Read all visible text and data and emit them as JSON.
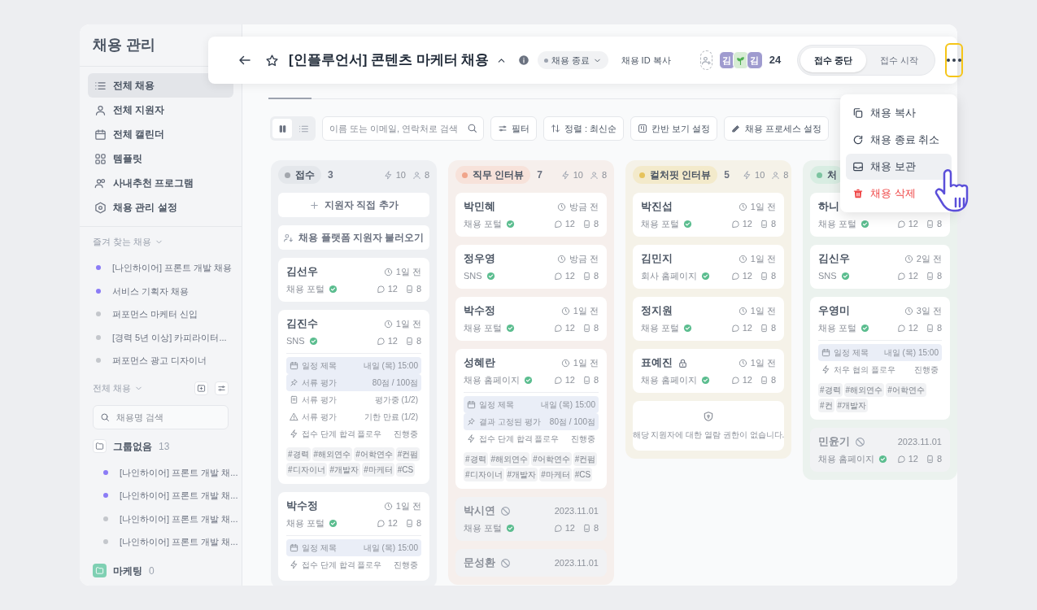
{
  "sidebar": {
    "title": "채용 관리",
    "nav": [
      {
        "label": "전체 채용",
        "selected": true
      },
      {
        "label": "전체 지원자",
        "selected": false
      },
      {
        "label": "전체 캘린더",
        "selected": false
      },
      {
        "label": "템플릿",
        "selected": false
      },
      {
        "label": "사내추천 프로그램",
        "selected": false
      },
      {
        "label": "채용 관리 설정",
        "selected": false
      }
    ],
    "favorites": {
      "title": "즐겨 찾는 채용",
      "items": [
        {
          "label": "[나인하이어] 프론트 개발 채용",
          "color": "#8b7cf6"
        },
        {
          "label": "서비스 기획자 채용",
          "color": "#8b7cf6"
        },
        {
          "label": "퍼포먼스 마케터 신입",
          "color": "#c4c7cc"
        },
        {
          "label": "[경력 5년 이상] 카피라이터...",
          "color": "#c4c7cc"
        },
        {
          "label": "퍼포먼스 광고 디자이너",
          "color": "#c4c7cc"
        }
      ]
    },
    "all_jobs": {
      "title": "전체 채용",
      "search": {
        "placeholder": "채용명 검색"
      },
      "groups": [
        {
          "kind": "plain",
          "name": "그룹없음",
          "count": "13",
          "items": [
            {
              "label": "[나인하이어] 프론트 개발 채...",
              "color": "#8b7cf6"
            },
            {
              "label": "[나인하이어] 프론트 개발 채...",
              "color": "#8b7cf6"
            },
            {
              "label": "[나인하이어] 프론트 개발 채...",
              "color": "#c4c7cc"
            },
            {
              "label": "[나인하이어] 프론트 개발 채...",
              "color": "#c4c7cc"
            }
          ]
        },
        {
          "kind": "green",
          "name": "마케팅",
          "count": "0"
        }
      ]
    }
  },
  "header": {
    "title": "[인플루언서] 콘텐츠 마케터 채용",
    "status": "채용 종료",
    "copy_id": "채용 ID 복사",
    "avatars": [
      {
        "kind": "letter",
        "text": "김"
      },
      {
        "kind": "sprout"
      },
      {
        "kind": "letter",
        "text": "김"
      }
    ],
    "applicant_count": "24",
    "toggle": [
      {
        "label": "접수 중단",
        "selected": true
      },
      {
        "label": "접수 시작",
        "selected": false
      }
    ],
    "more_highlighted": true
  },
  "toolbar": {
    "views": [
      {
        "kind": "kanban",
        "selected": true
      },
      {
        "kind": "list",
        "selected": false
      }
    ],
    "search": {
      "placeholder": "이름 또는 이메일, 연락처로 검색"
    },
    "buttons": [
      {
        "label": "필터"
      },
      {
        "label": "정렬 : 최신순"
      },
      {
        "label": "칸반 보기 설정"
      },
      {
        "label": "채용 프로세스 설정"
      }
    ]
  },
  "columns": [
    {
      "label": "접수",
      "color": "#a3a7ad",
      "count": "3",
      "stat_a": "10",
      "stat_b": "8",
      "actions": [
        {
          "label": "지원자 직접 추가"
        },
        {
          "label": "채용 플랫폼 지원자 불러오기"
        }
      ],
      "cards": [
        {
          "kind": "normal",
          "name": "김선우",
          "time": "1일 전",
          "source": "채용 포털",
          "comments": "12",
          "files": "8"
        },
        {
          "kind": "normal",
          "name": "김진수",
          "time": "1일 전",
          "source": "SNS",
          "comments": "12",
          "files": "8",
          "details": [
            {
              "kind": "schedule",
              "label": "일정 제목",
              "value": "내일 (목) 15:00",
              "highlighted": true
            },
            {
              "kind": "score",
              "label": "서류 평가",
              "value": "80점 / 100점",
              "highlighted": true
            },
            {
              "kind": "review",
              "label": "서류 평가",
              "value": "평가중 (1/2)",
              "highlighted": false
            },
            {
              "kind": "overdue",
              "label": "서류 평가",
              "value": "기한 만료 (1/2)",
              "highlighted": false
            },
            {
              "kind": "flow",
              "label": "접수 단계 합격 플로우",
              "value": "진행중",
              "highlighted": false
            }
          ],
          "tags": [
            "#경력",
            "#해외연수",
            "#어학연수",
            "#컨펌",
            "#디자이너",
            "#개발자",
            "#마케터",
            "#CS"
          ]
        },
        {
          "kind": "normal",
          "name": "박수정",
          "time": "1일 전",
          "source": "채용 포털",
          "comments": "12",
          "files": "8",
          "details": [
            {
              "kind": "schedule",
              "label": "일정 제목",
              "value": "내일 (목) 15:00",
              "highlighted": true
            },
            {
              "kind": "flow",
              "label": "접수 단계 합격 플로우",
              "value": "진행중",
              "highlighted": false
            }
          ]
        }
      ]
    },
    {
      "label": "직무 인터뷰",
      "color": "#f0a48a",
      "count": "7",
      "stat_a": "10",
      "stat_b": "8",
      "cards": [
        {
          "kind": "normal",
          "name": "박민혜",
          "time": "방금 전",
          "source": "채용 포털",
          "comments": "12",
          "files": "8"
        },
        {
          "kind": "normal",
          "name": "정우영",
          "time": "방금 전",
          "source": "SNS",
          "comments": "12",
          "files": "8"
        },
        {
          "kind": "normal",
          "name": "박수정",
          "time": "1일 전",
          "source": "채용 포털",
          "comments": "12",
          "files": "8"
        },
        {
          "kind": "normal",
          "name": "성혜란",
          "time": "1일 전",
          "source": "채용 홈페이지",
          "comments": "12",
          "files": "8",
          "details": [
            {
              "kind": "schedule",
              "label": "일정 제목",
              "value": "내일 (목) 15:00",
              "highlighted": true
            },
            {
              "kind": "score",
              "label": "결과 고정된 평가",
              "value": "80점 / 100점",
              "highlighted": true
            },
            {
              "kind": "flow",
              "label": "접수 단계 합격 플로우",
              "value": "진행중",
              "highlighted": false
            }
          ],
          "tags": [
            "#경력",
            "#해외연수",
            "#어학연수",
            "#컨펌",
            "#디자이너",
            "#개발자",
            "#마케터",
            "#CS"
          ]
        },
        {
          "kind": "rejected",
          "name": "박시연",
          "time": "2023.11.01",
          "source": "채용 포털",
          "comments": "12",
          "files": "8"
        },
        {
          "kind": "rejected",
          "name": "문성환",
          "time": "2023.11.01"
        }
      ]
    },
    {
      "label": "컬처핏 인터뷰",
      "color": "#e6c35c",
      "count": "5",
      "stat_a": "10",
      "stat_b": "8",
      "cards": [
        {
          "kind": "normal",
          "name": "박진섭",
          "time": "1일 전",
          "source": "채용 포털",
          "comments": "12",
          "files": "8"
        },
        {
          "kind": "normal",
          "name": "김민지",
          "time": "1일 전",
          "source": "회사 홈페이지",
          "comments": "12",
          "files": "8"
        },
        {
          "kind": "normal",
          "name": "정지원",
          "time": "1일 전",
          "source": "채용 포털",
          "comments": "12",
          "files": "8"
        },
        {
          "kind": "locked",
          "name": "표예진",
          "time": "1일 전",
          "source": "채용 홈페이지",
          "comments": "12",
          "files": "8"
        },
        {
          "kind": "notice",
          "text": "해당 지원자에 대한 열람 권한이 없습니다."
        }
      ]
    },
    {
      "label": "처",
      "color": "#7cc4a0",
      "cards": [
        {
          "kind": "normal",
          "name": "하니",
          "source": "채용 포털",
          "comments": "12",
          "files": "8"
        },
        {
          "kind": "normal",
          "name": "김신우",
          "time": "2일 전",
          "source": "SNS",
          "comments": "12",
          "files": "8"
        },
        {
          "kind": "normal",
          "name": "우영미",
          "time": "3일 전",
          "source": "채용 포털",
          "comments": "12",
          "files": "8",
          "details": [
            {
              "kind": "schedule",
              "label": "일정 제목",
              "value": "내일 (목) 15:00",
              "highlighted": true
            },
            {
              "kind": "flow",
              "label": "처우 협의 플로우",
              "value": "진행중",
              "highlighted": false
            }
          ],
          "tags": [
            "#경력",
            "#해외연수",
            "#어학연수",
            "#컨",
            "#개발자"
          ]
        },
        {
          "kind": "rejected",
          "name": "민윤기",
          "time": "2023.11.01",
          "source": "채용 홈페이지",
          "comments": "12",
          "files": "8"
        }
      ]
    }
  ],
  "menu": {
    "items": [
      {
        "kind": "normal",
        "label": "채용 복사",
        "hovered": false
      },
      {
        "kind": "normal",
        "label": "채용 종료 취소",
        "hovered": false
      },
      {
        "kind": "normal",
        "label": "채용 보관",
        "hovered": true
      },
      {
        "kind": "danger",
        "label": "채용 삭제",
        "hovered": false
      }
    ]
  }
}
